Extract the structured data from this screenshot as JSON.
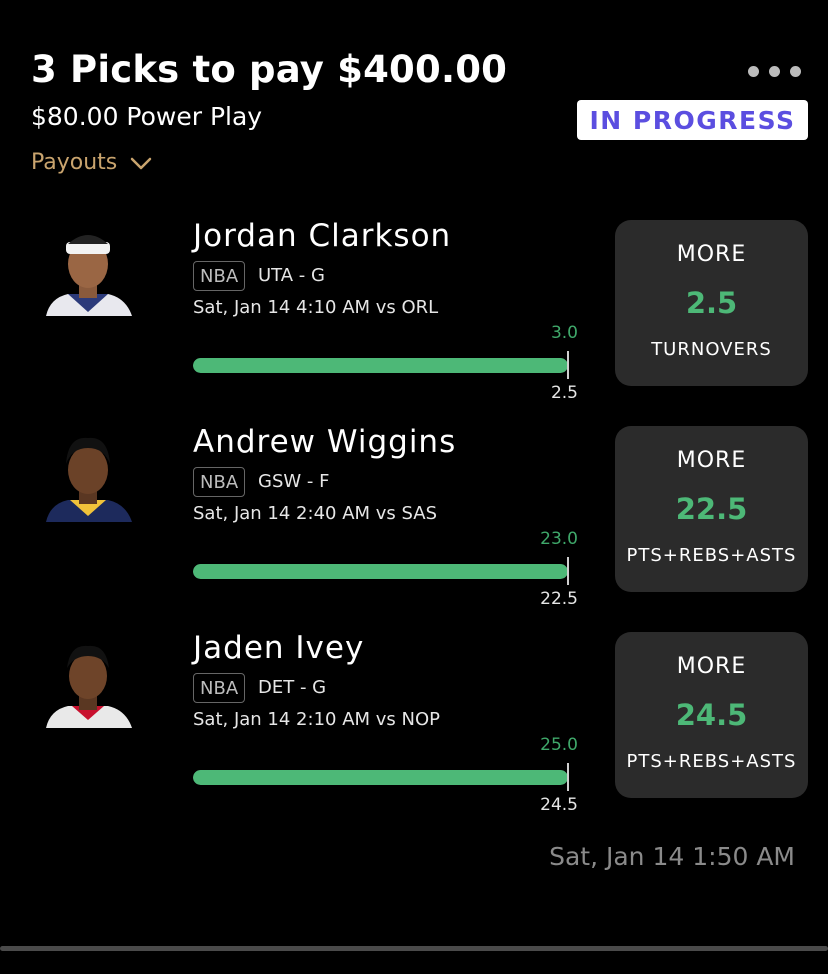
{
  "header": {
    "title": "3 Picks to pay $400.00",
    "subtitle": "$80.00 Power Play",
    "payouts_label": "Payouts",
    "status": "IN PROGRESS"
  },
  "picks": [
    {
      "name": "Jordan Clarkson",
      "league": "NBA",
      "team_pos": "UTA - G",
      "game_time": "Sat, Jan 14 4:10 AM  vs ORL",
      "actual": "3.0",
      "line": "2.5",
      "progress_fraction": 1.0,
      "direction": "MORE",
      "pick_line": "2.5",
      "stat": "TURNOVERS"
    },
    {
      "name": "Andrew Wiggins",
      "league": "NBA",
      "team_pos": "GSW - F",
      "game_time": "Sat, Jan 14 2:40 AM  vs SAS",
      "actual": "23.0",
      "line": "22.5",
      "progress_fraction": 1.0,
      "direction": "MORE",
      "pick_line": "22.5",
      "stat": "PTS+REBS+ASTS"
    },
    {
      "name": "Jaden Ivey",
      "league": "NBA",
      "team_pos": "DET - G",
      "game_time": "Sat, Jan 14 2:10 AM  vs NOP",
      "actual": "25.0",
      "line": "24.5",
      "progress_fraction": 1.0,
      "direction": "MORE",
      "pick_line": "24.5",
      "stat": "PTS+REBS+ASTS"
    }
  ],
  "footer": {
    "timestamp": "Sat, Jan 14 1:50 AM"
  },
  "colors": {
    "accent_green": "#4db877",
    "status_purple": "#5b4ee0",
    "payouts_gold": "#c9a46e"
  }
}
